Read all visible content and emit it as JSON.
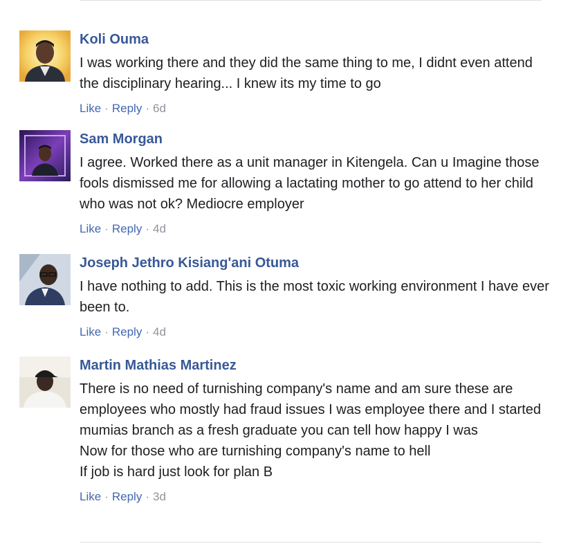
{
  "comments": [
    {
      "author": "Koli Ouma",
      "text": "I was working there and they did the same thing to me, I didnt even attend the disciplinary hearing... I knew its my time to go",
      "like": "Like",
      "reply": "Reply",
      "time": "6d",
      "avatar": "avatar-man-yellow-bg"
    },
    {
      "author": "Sam Morgan",
      "text": "I agree. Worked there as a unit manager in Kitengela. Can u Imagine those fools dismissed me for allowing a lactating mother to go attend to her child who was not ok? Mediocre employer",
      "like": "Like",
      "reply": "Reply",
      "time": "4d",
      "avatar": "avatar-man-purple-bg"
    },
    {
      "author": "Joseph Jethro Kisiang'ani Otuma",
      "text": "I have nothing to add. This is the most toxic working environment I have ever been to.",
      "like": "Like",
      "reply": "Reply",
      "time": "4d",
      "avatar": "avatar-man-glasses"
    },
    {
      "author": "Martin Mathias Martinez",
      "text": "There is no need of turnishing company's name and am sure these are employees who mostly had fraud issues I was employee there and I started mumias branch as a fresh graduate you can tell how happy I was\nNow for those who are turnishing company's name to hell\nIf job is hard just look for plan B",
      "like": "Like",
      "reply": "Reply",
      "time": "3d",
      "avatar": "avatar-man-cap"
    }
  ],
  "colors": {
    "author": "#385898",
    "action_link": "#4267b2",
    "meta": "#90949c",
    "text": "#1c1e21",
    "divider": "#dddfe2"
  }
}
